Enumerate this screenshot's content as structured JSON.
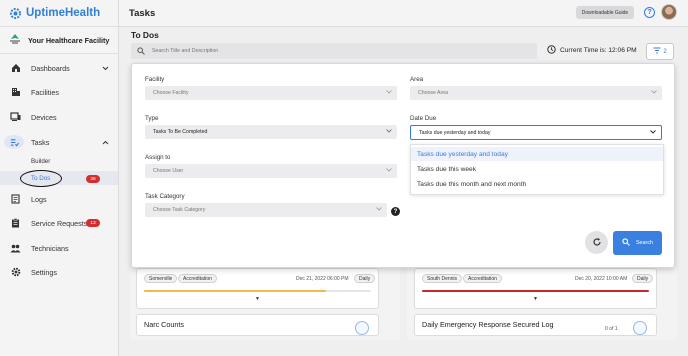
{
  "app": {
    "brand": "UptimeHealth",
    "facility_name": "Your Healthcare Facility"
  },
  "sidebar": {
    "dashboards": "Dashboards",
    "facilities": "Facilities",
    "devices": "Devices",
    "tasks": "Tasks",
    "builder": "Builder",
    "todos": "To Dos",
    "todos_badge": "36",
    "logs": "Logs",
    "service_requests": "Service Requests",
    "service_requests_badge": "13",
    "technicians": "Technicians",
    "settings": "Settings"
  },
  "header": {
    "title": "Tasks",
    "download_guide": "Downloadable Guide",
    "help": "?"
  },
  "main": {
    "subtitle": "To Dos",
    "search_placeholder": "Search Title and Description",
    "time": "Current Time is: 12:06 PM",
    "filter_count": "2"
  },
  "filters": {
    "facility_label": "Facility",
    "facility_placeholder": "Choose Facility",
    "area_label": "Area",
    "area_placeholder": "Choose Area",
    "type_label": "Type",
    "type_value": "Tasks To Be Completed",
    "date_due_label": "Date Due",
    "date_due_value": "Tasks due yesterday and today",
    "assign_label": "Assign to",
    "assign_placeholder": "Choose User",
    "category_label": "Task Category",
    "category_placeholder": "Choose Task Category",
    "info": "?",
    "date_options": [
      "Tasks due yesterday and today",
      "Tasks due this week",
      "Tasks due this month and next month"
    ],
    "search_button": "Search"
  },
  "cards": [
    {
      "location": "Somerville",
      "tag": "Accreditation",
      "date": "Dec 21, 2022 06:00 PM",
      "frequency": "Daily",
      "bar_color": "#f2b84b",
      "progress": 0.8
    },
    {
      "location": "South Dennis",
      "tag": "Accreditation",
      "date": "Dec 20, 2022 10:00 AM",
      "frequency": "Daily",
      "bar_color": "#c62828",
      "progress": 1.0
    }
  ],
  "next_cards": {
    "left_title": "Narc Counts",
    "right_title": "Daily Emergency Response Secured Log",
    "right_count": "0 of 1"
  }
}
